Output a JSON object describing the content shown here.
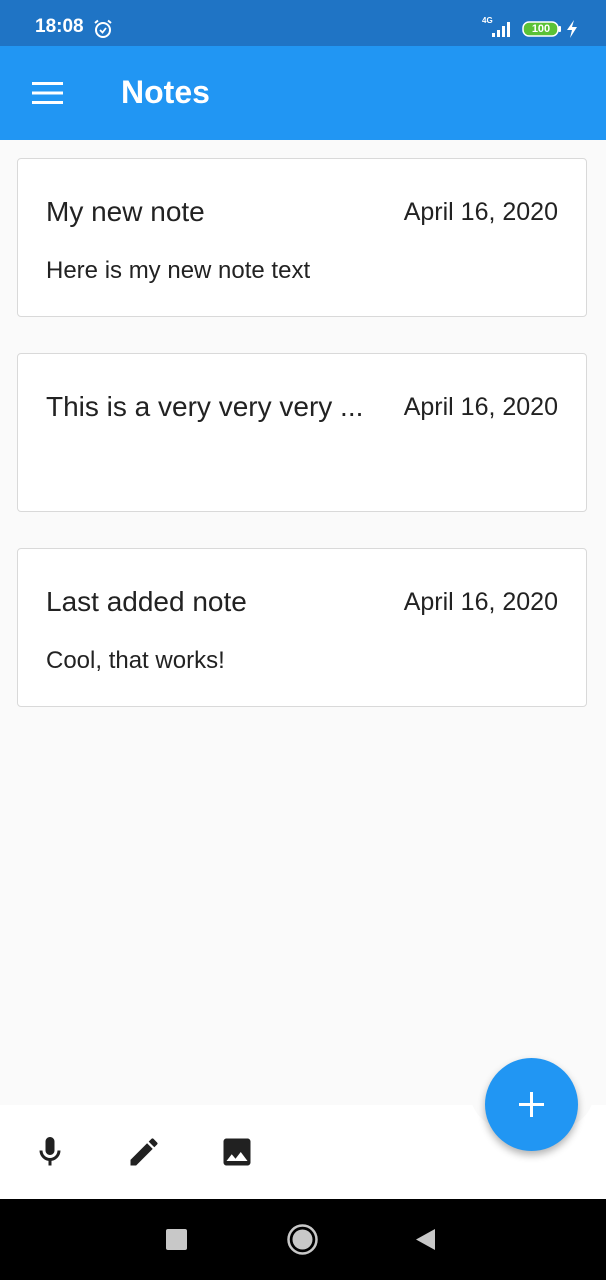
{
  "status_bar": {
    "time": "18:08",
    "network": "4G",
    "battery": "100"
  },
  "app_bar": {
    "title": "Notes"
  },
  "notes": [
    {
      "title": "My new note",
      "date": "April 16, 2020",
      "body": "Here is my new note text"
    },
    {
      "title": "This is a very very very ...",
      "date": "April 16, 2020",
      "body": ""
    },
    {
      "title": "Last added note",
      "date": "April 16, 2020",
      "body": "Cool, that works!"
    }
  ],
  "bottom_bar": {
    "icons": [
      "microphone-icon",
      "pencil-icon",
      "image-icon"
    ]
  },
  "fab": {
    "icon": "plus-icon"
  },
  "colors": {
    "primary": "#2196f3",
    "status_bar": "#1f74c5",
    "background": "#fafafa"
  }
}
